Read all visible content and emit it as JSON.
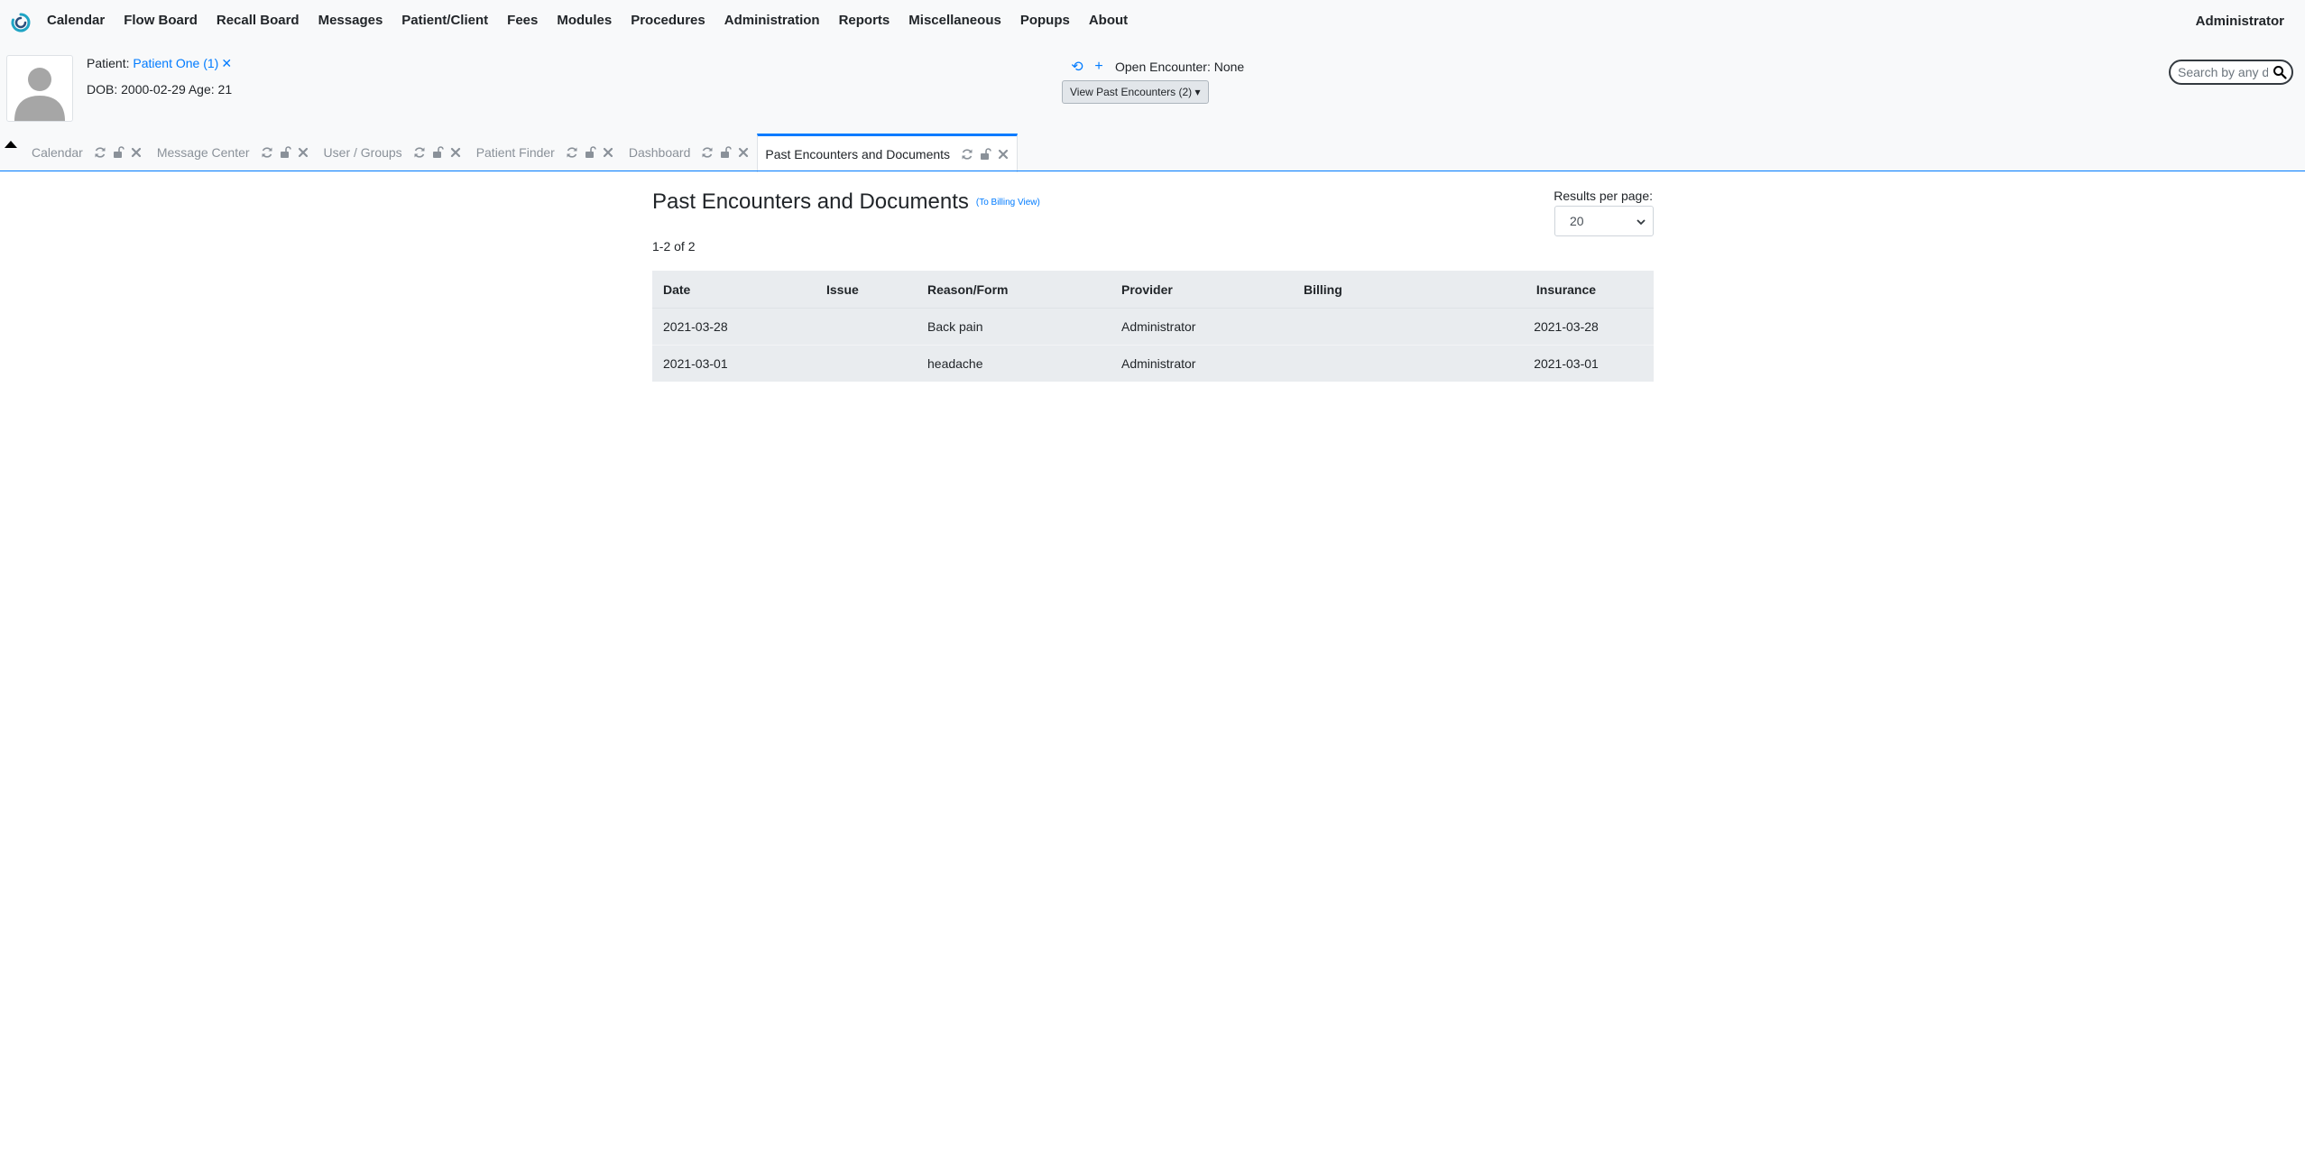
{
  "menu": {
    "items": [
      "Calendar",
      "Flow Board",
      "Recall Board",
      "Messages",
      "Patient/Client",
      "Fees",
      "Modules",
      "Procedures",
      "Administration",
      "Reports",
      "Miscellaneous",
      "Popups",
      "About"
    ],
    "user": "Administrator"
  },
  "patient": {
    "label": "Patient:",
    "name_link": "Patient One (1)",
    "dob_line": "DOB: 2000-02-29 Age: 21"
  },
  "encounter": {
    "open_text": "Open Encounter: None",
    "past_button": "View Past Encounters  (2)"
  },
  "search": {
    "placeholder": "Search by any demographics"
  },
  "tabs": [
    {
      "label": "Calendar",
      "active": false
    },
    {
      "label": "Message Center",
      "active": false
    },
    {
      "label": "User / Groups",
      "active": false
    },
    {
      "label": "Patient Finder",
      "active": false
    },
    {
      "label": "Dashboard",
      "active": false
    },
    {
      "label": "Past Encounters and Documents",
      "active": true
    }
  ],
  "page": {
    "title": "Past Encounters and Documents",
    "billing_link": "(To Billing View)",
    "count": "1-2 of 2",
    "results_per_page_label": "Results per page:",
    "results_per_page_value": "20"
  },
  "table": {
    "headers": [
      "Date",
      "Issue",
      "Reason/Form",
      "Provider",
      "Billing",
      "Insurance"
    ],
    "rows": [
      [
        "2021-03-28",
        "",
        "Back pain",
        "Administrator",
        "",
        "2021-03-28"
      ],
      [
        "2021-03-01",
        "",
        "headache",
        "Administrator",
        "",
        "2021-03-01"
      ]
    ]
  },
  "colors": {
    "accent": "#007bff",
    "topbar_bg": "#f8f9fa",
    "table_bg": "#e9ecef",
    "logo_teal": "#1fa4c4"
  }
}
